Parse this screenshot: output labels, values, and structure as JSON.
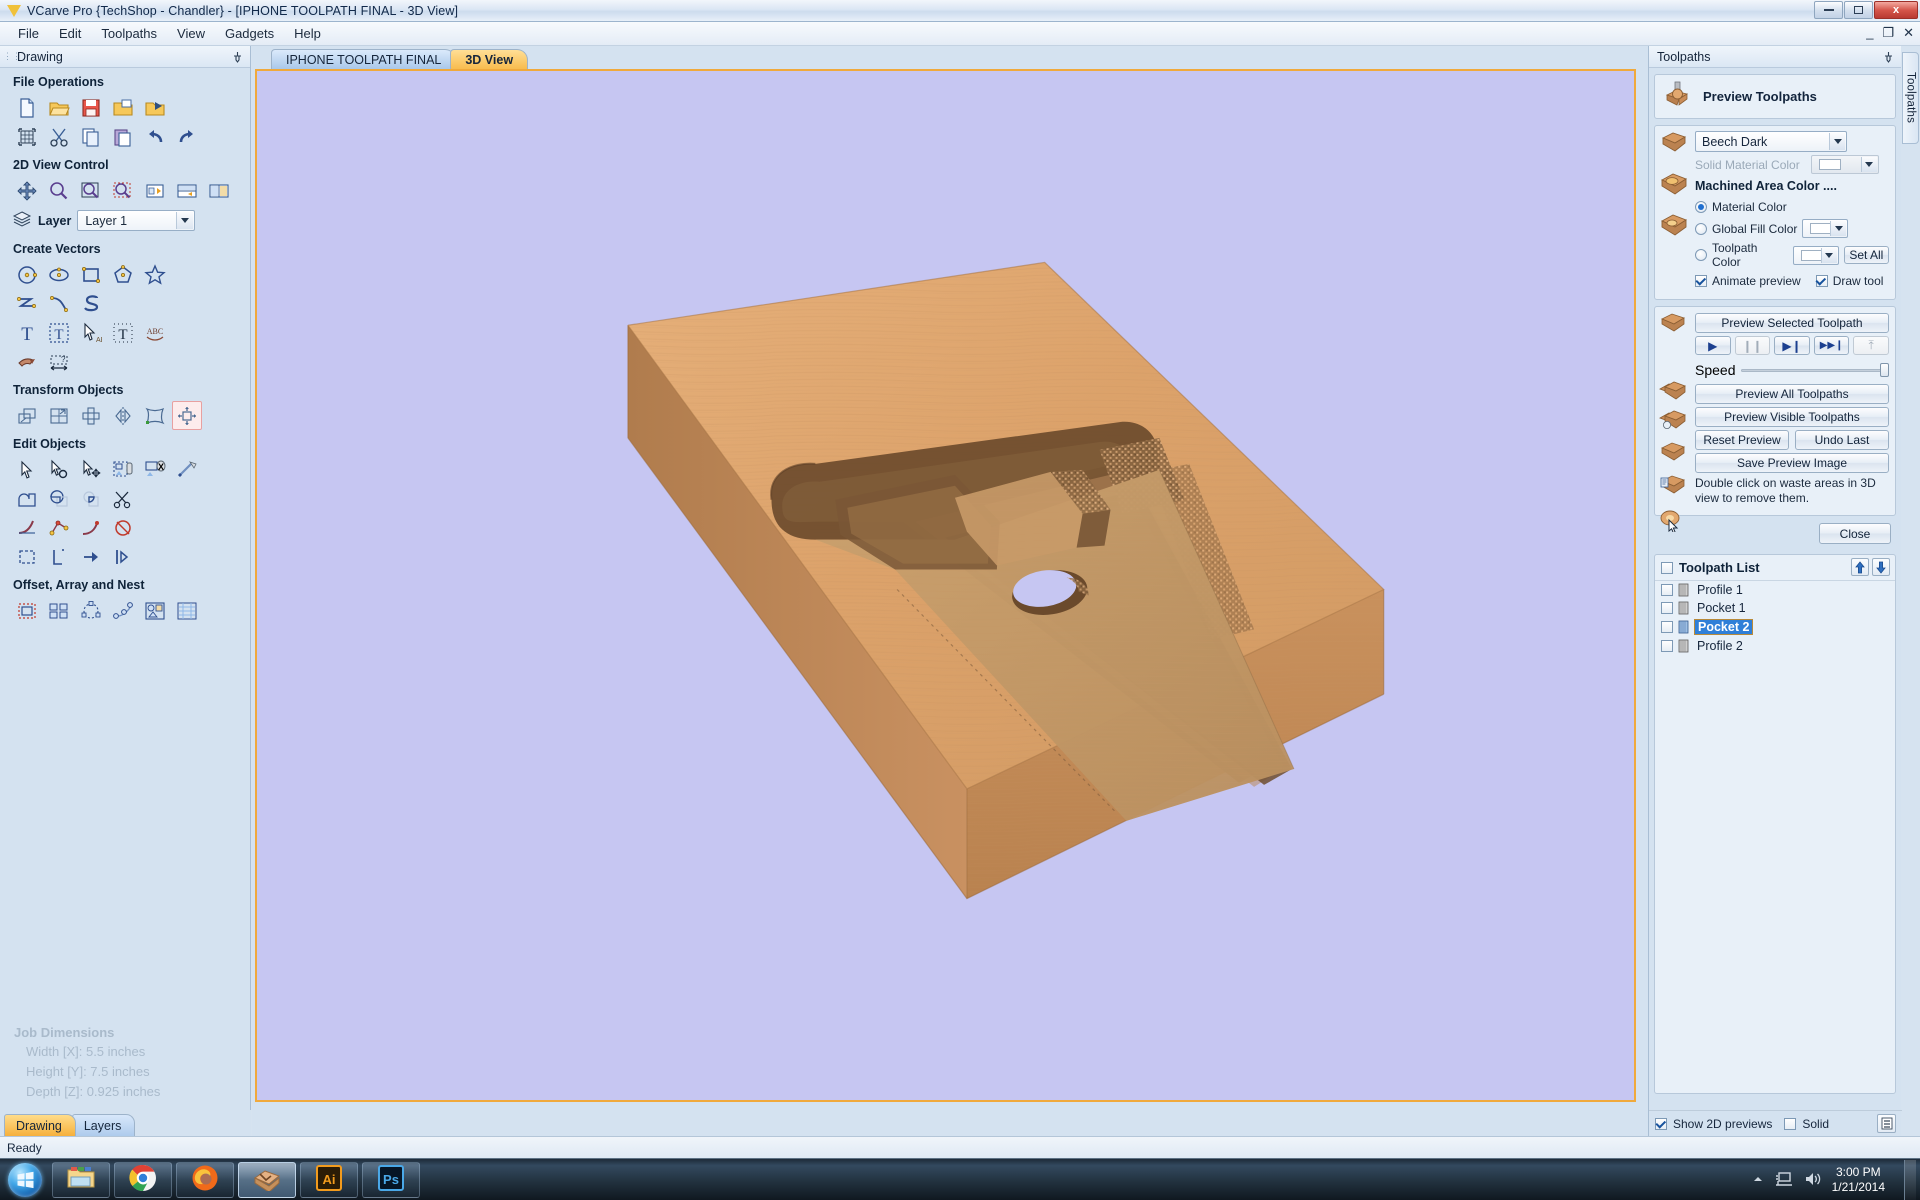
{
  "window": {
    "title": "VCarve Pro {TechShop - Chandler} - [IPHONE TOOLPATH FINAL - 3D View]",
    "minimize_label": "Minimize",
    "maximize_label": "Restore",
    "close_label": "x",
    "mdi_minimize": "_",
    "mdi_restore": "❐",
    "mdi_close": "✕"
  },
  "menu": {
    "items": [
      {
        "label": "File"
      },
      {
        "label": "Edit"
      },
      {
        "label": "Toolpaths"
      },
      {
        "label": "View"
      },
      {
        "label": "Gadgets"
      },
      {
        "label": "Help"
      }
    ]
  },
  "left_panel": {
    "title": "Drawing",
    "pin_icon": "pin-icon",
    "sections": [
      {
        "title": "File Operations",
        "rows": [
          [
            {
              "icon": "new-file-icon",
              "name": "new-file"
            },
            {
              "icon": "open-folder-icon",
              "name": "open-file"
            },
            {
              "icon": "save-icon",
              "name": "save-file"
            },
            {
              "icon": "import-vectors-icon",
              "name": "import-vectors"
            },
            {
              "icon": "import-bitmap-icon",
              "name": "import-bitmap"
            }
          ],
          [
            {
              "icon": "job-setup-icon",
              "name": "job-setup"
            },
            {
              "icon": "cut-icon",
              "name": "cut"
            },
            {
              "icon": "copy-icon",
              "name": "copy"
            },
            {
              "icon": "paste-icon",
              "name": "paste"
            },
            {
              "icon": "undo-icon",
              "name": "undo"
            },
            {
              "icon": "redo-icon",
              "name": "redo"
            }
          ]
        ]
      },
      {
        "title": "2D View Control",
        "rows": [
          [
            {
              "icon": "pan-icon",
              "name": "pan-view"
            },
            {
              "icon": "zoom-icon",
              "name": "zoom"
            },
            {
              "icon": "zoom-selected-icon",
              "name": "zoom-selected"
            },
            {
              "icon": "zoom-box-icon",
              "name": "zoom-box"
            },
            {
              "icon": "zoom-extents-icon",
              "name": "zoom-extents"
            },
            {
              "icon": "two-view-icon",
              "name": "two-view-layout"
            },
            {
              "icon": "split-view-icon",
              "name": "split-view-layout"
            }
          ]
        ]
      },
      {
        "title": "Create Vectors",
        "rows": [
          [
            {
              "icon": "circle-icon",
              "name": "draw-circle"
            },
            {
              "icon": "ellipse-icon",
              "name": "draw-ellipse"
            },
            {
              "icon": "rectangle-icon",
              "name": "draw-rectangle"
            },
            {
              "icon": "polygon-icon",
              "name": "draw-polygon"
            },
            {
              "icon": "star-icon",
              "name": "draw-star"
            }
          ],
          [
            {
              "icon": "polyline-icon",
              "name": "draw-polyline"
            },
            {
              "icon": "curve-icon",
              "name": "draw-curve"
            },
            {
              "icon": "spiral-icon",
              "name": "draw-spiral"
            }
          ],
          [
            {
              "icon": "text-icon",
              "name": "create-text"
            },
            {
              "icon": "text-box-icon",
              "name": "text-in-box"
            },
            {
              "icon": "text-select-icon",
              "name": "edit-text"
            },
            {
              "icon": "text-transform-icon",
              "name": "transform-text"
            },
            {
              "icon": "text-on-curve-icon",
              "name": "text-on-curve"
            }
          ],
          [
            {
              "icon": "trace-bitmap-icon",
              "name": "trace-bitmap"
            },
            {
              "icon": "dimension-icon",
              "name": "dimension-tool"
            }
          ]
        ]
      },
      {
        "title": "Transform Objects",
        "rows": [
          [
            {
              "icon": "move-icon",
              "name": "move-objects"
            },
            {
              "icon": "scale-icon",
              "name": "scale-objects"
            },
            {
              "icon": "rotate-icon",
              "name": "rotate-objects"
            },
            {
              "icon": "mirror-icon",
              "name": "mirror-objects"
            },
            {
              "icon": "distort-icon",
              "name": "distort-objects"
            },
            {
              "icon": "align-icon",
              "name": "align-objects",
              "selected": true
            }
          ]
        ]
      },
      {
        "title": "Edit Objects",
        "rows": [
          [
            {
              "icon": "select-icon",
              "name": "select-tool"
            },
            {
              "icon": "node-edit-icon",
              "name": "node-edit"
            },
            {
              "icon": "move-nodes-icon",
              "name": "move-nodes"
            },
            {
              "icon": "group-icon",
              "name": "group-objects"
            },
            {
              "icon": "ungroup-icon",
              "name": "ungroup-objects"
            },
            {
              "icon": "join-vectors-icon",
              "name": "join-vectors"
            }
          ],
          [
            {
              "icon": "weld-icon",
              "name": "weld-vectors"
            },
            {
              "icon": "subtract-icon",
              "name": "subtract-vectors"
            },
            {
              "icon": "intersect-icon",
              "name": "intersect-vectors"
            },
            {
              "icon": "trim-icon",
              "name": "trim-vectors"
            }
          ],
          [
            {
              "icon": "fillet-icon",
              "name": "create-fillet"
            },
            {
              "icon": "node-points-icon",
              "name": "edit-node-points"
            },
            {
              "icon": "curve-fit-icon",
              "name": "curve-fit"
            },
            {
              "icon": "offset-curve-icon",
              "name": "offset-curve"
            }
          ],
          [
            {
              "icon": "closed-vector-icon",
              "name": "close-vector"
            },
            {
              "icon": "open-vector-icon",
              "name": "open-vector"
            },
            {
              "icon": "reverse-icon",
              "name": "reverse-direction"
            },
            {
              "icon": "start-point-icon",
              "name": "set-start-point"
            }
          ]
        ]
      },
      {
        "title": "Offset, Array and Nest",
        "rows": [
          [
            {
              "icon": "offset-icon",
              "name": "offset-vectors"
            },
            {
              "icon": "block-copy-icon",
              "name": "block-copy"
            },
            {
              "icon": "circular-copy-icon",
              "name": "circular-copy"
            },
            {
              "icon": "copy-along-curve-icon",
              "name": "copy-along-curve"
            },
            {
              "icon": "nest-icon",
              "name": "nest-objects"
            },
            {
              "icon": "texture-icon",
              "name": "texture-tool"
            }
          ]
        ]
      }
    ],
    "layer": {
      "label": "Layer",
      "value": "Layer 1",
      "icon": "layers-icon"
    },
    "job_dimensions": {
      "title": "Job Dimensions",
      "lines": [
        "Width  [X]: 5.5 inches",
        "Height [Y]: 7.5 inches",
        "Depth  [Z]: 0.925 inches"
      ]
    },
    "tabs": [
      {
        "label": "Drawing",
        "active": true
      },
      {
        "label": "Layers",
        "active": false
      }
    ]
  },
  "document_tabs": [
    {
      "label": "IPHONE TOOLPATH FINAL",
      "active": false
    },
    {
      "label": "3D View",
      "active": true
    }
  ],
  "view3d": {
    "background_color": "#c6c6f2",
    "material_top_color": "#e0a86e",
    "material_side_color": "#c08f5e",
    "pocket_color": "#7a5634",
    "border_color": "#f0a93c"
  },
  "toolpaths_panel": {
    "title": "Toolpaths",
    "pin_icon": "pin-icon",
    "vertical_tab_label": "Toolpaths",
    "preview_header": {
      "label": "Preview Toolpaths",
      "icon": "router-bit-icon"
    },
    "material": {
      "selected": "Beech Dark",
      "options": [
        "Beech Dark"
      ],
      "solid_material_color_label": "Solid Material Color",
      "icon": "material-block-icon"
    },
    "machined_area": {
      "title": "Machined Area Color ....",
      "options": [
        {
          "label": "Material Color",
          "selected": true,
          "has_color": false
        },
        {
          "label": "Global Fill Color",
          "selected": false,
          "has_color": true
        },
        {
          "label": "Toolpath Color",
          "selected": false,
          "has_color": true
        }
      ],
      "set_all_label": "Set All",
      "checkboxes": [
        {
          "label": "Animate preview",
          "checked": true
        },
        {
          "label": "Draw tool",
          "checked": true
        }
      ]
    },
    "preview_controls": {
      "preview_selected_label": "Preview Selected Toolpath",
      "transport": [
        {
          "name": "play-button",
          "glyph": "▶",
          "enabled": true
        },
        {
          "name": "pause-button",
          "glyph": "❙❙",
          "enabled": false
        },
        {
          "name": "step-button",
          "glyph": "▶❙",
          "enabled": true
        },
        {
          "name": "fast-forward-button",
          "glyph": "▶▶❙",
          "enabled": true
        },
        {
          "name": "end-button",
          "glyph": "⤒",
          "enabled": false
        }
      ],
      "speed_label": "Speed",
      "speed_value": 100,
      "preview_all_label": "Preview All Toolpaths",
      "preview_visible_label": "Preview Visible Toolpaths",
      "reset_preview_label": "Reset Preview",
      "undo_last_label": "Undo Last",
      "save_preview_image_label": "Save Preview Image",
      "hint_text": "Double click on waste areas in 3D view to remove them.",
      "hint_icon": "cursor-icon",
      "close_label": "Close"
    }
  },
  "toolpath_list": {
    "title": "Toolpath List",
    "header_checkbox": false,
    "move_up_icon": "arrow-up-icon",
    "move_down_icon": "arrow-down-icon",
    "items": [
      {
        "name": "Profile 1",
        "checked": false,
        "selected": false
      },
      {
        "name": "Pocket 1",
        "checked": false,
        "selected": false
      },
      {
        "name": "Pocket 2",
        "checked": false,
        "selected": true
      },
      {
        "name": "Profile 2",
        "checked": false,
        "selected": false
      }
    ],
    "footer": {
      "show_2d_previews": {
        "label": "Show 2D previews",
        "checked": true
      },
      "solid": {
        "label": "Solid",
        "checked": false
      },
      "list_button_icon": "list-icon"
    }
  },
  "status_bar": {
    "text": "Ready"
  },
  "taskbar": {
    "start_label": "Start",
    "items": [
      {
        "name": "windows-explorer",
        "icon": "folder-icon",
        "active": false
      },
      {
        "name": "google-chrome",
        "icon": "chrome-icon",
        "active": false
      },
      {
        "name": "mozilla-firefox",
        "icon": "firefox-icon",
        "active": false
      },
      {
        "name": "vcarve-pro",
        "icon": "vcarve-icon",
        "active": true
      },
      {
        "name": "adobe-illustrator",
        "icon": "illustrator-icon",
        "label": "Ai",
        "active": false
      },
      {
        "name": "adobe-photoshop",
        "icon": "photoshop-icon",
        "label": "Ps",
        "active": false
      }
    ],
    "tray": {
      "show_hidden_icon": "chevron-up-icon",
      "network_icon": "network-icon",
      "volume_icon": "speaker-icon",
      "time": "3:00 PM",
      "date": "1/21/2014"
    }
  }
}
